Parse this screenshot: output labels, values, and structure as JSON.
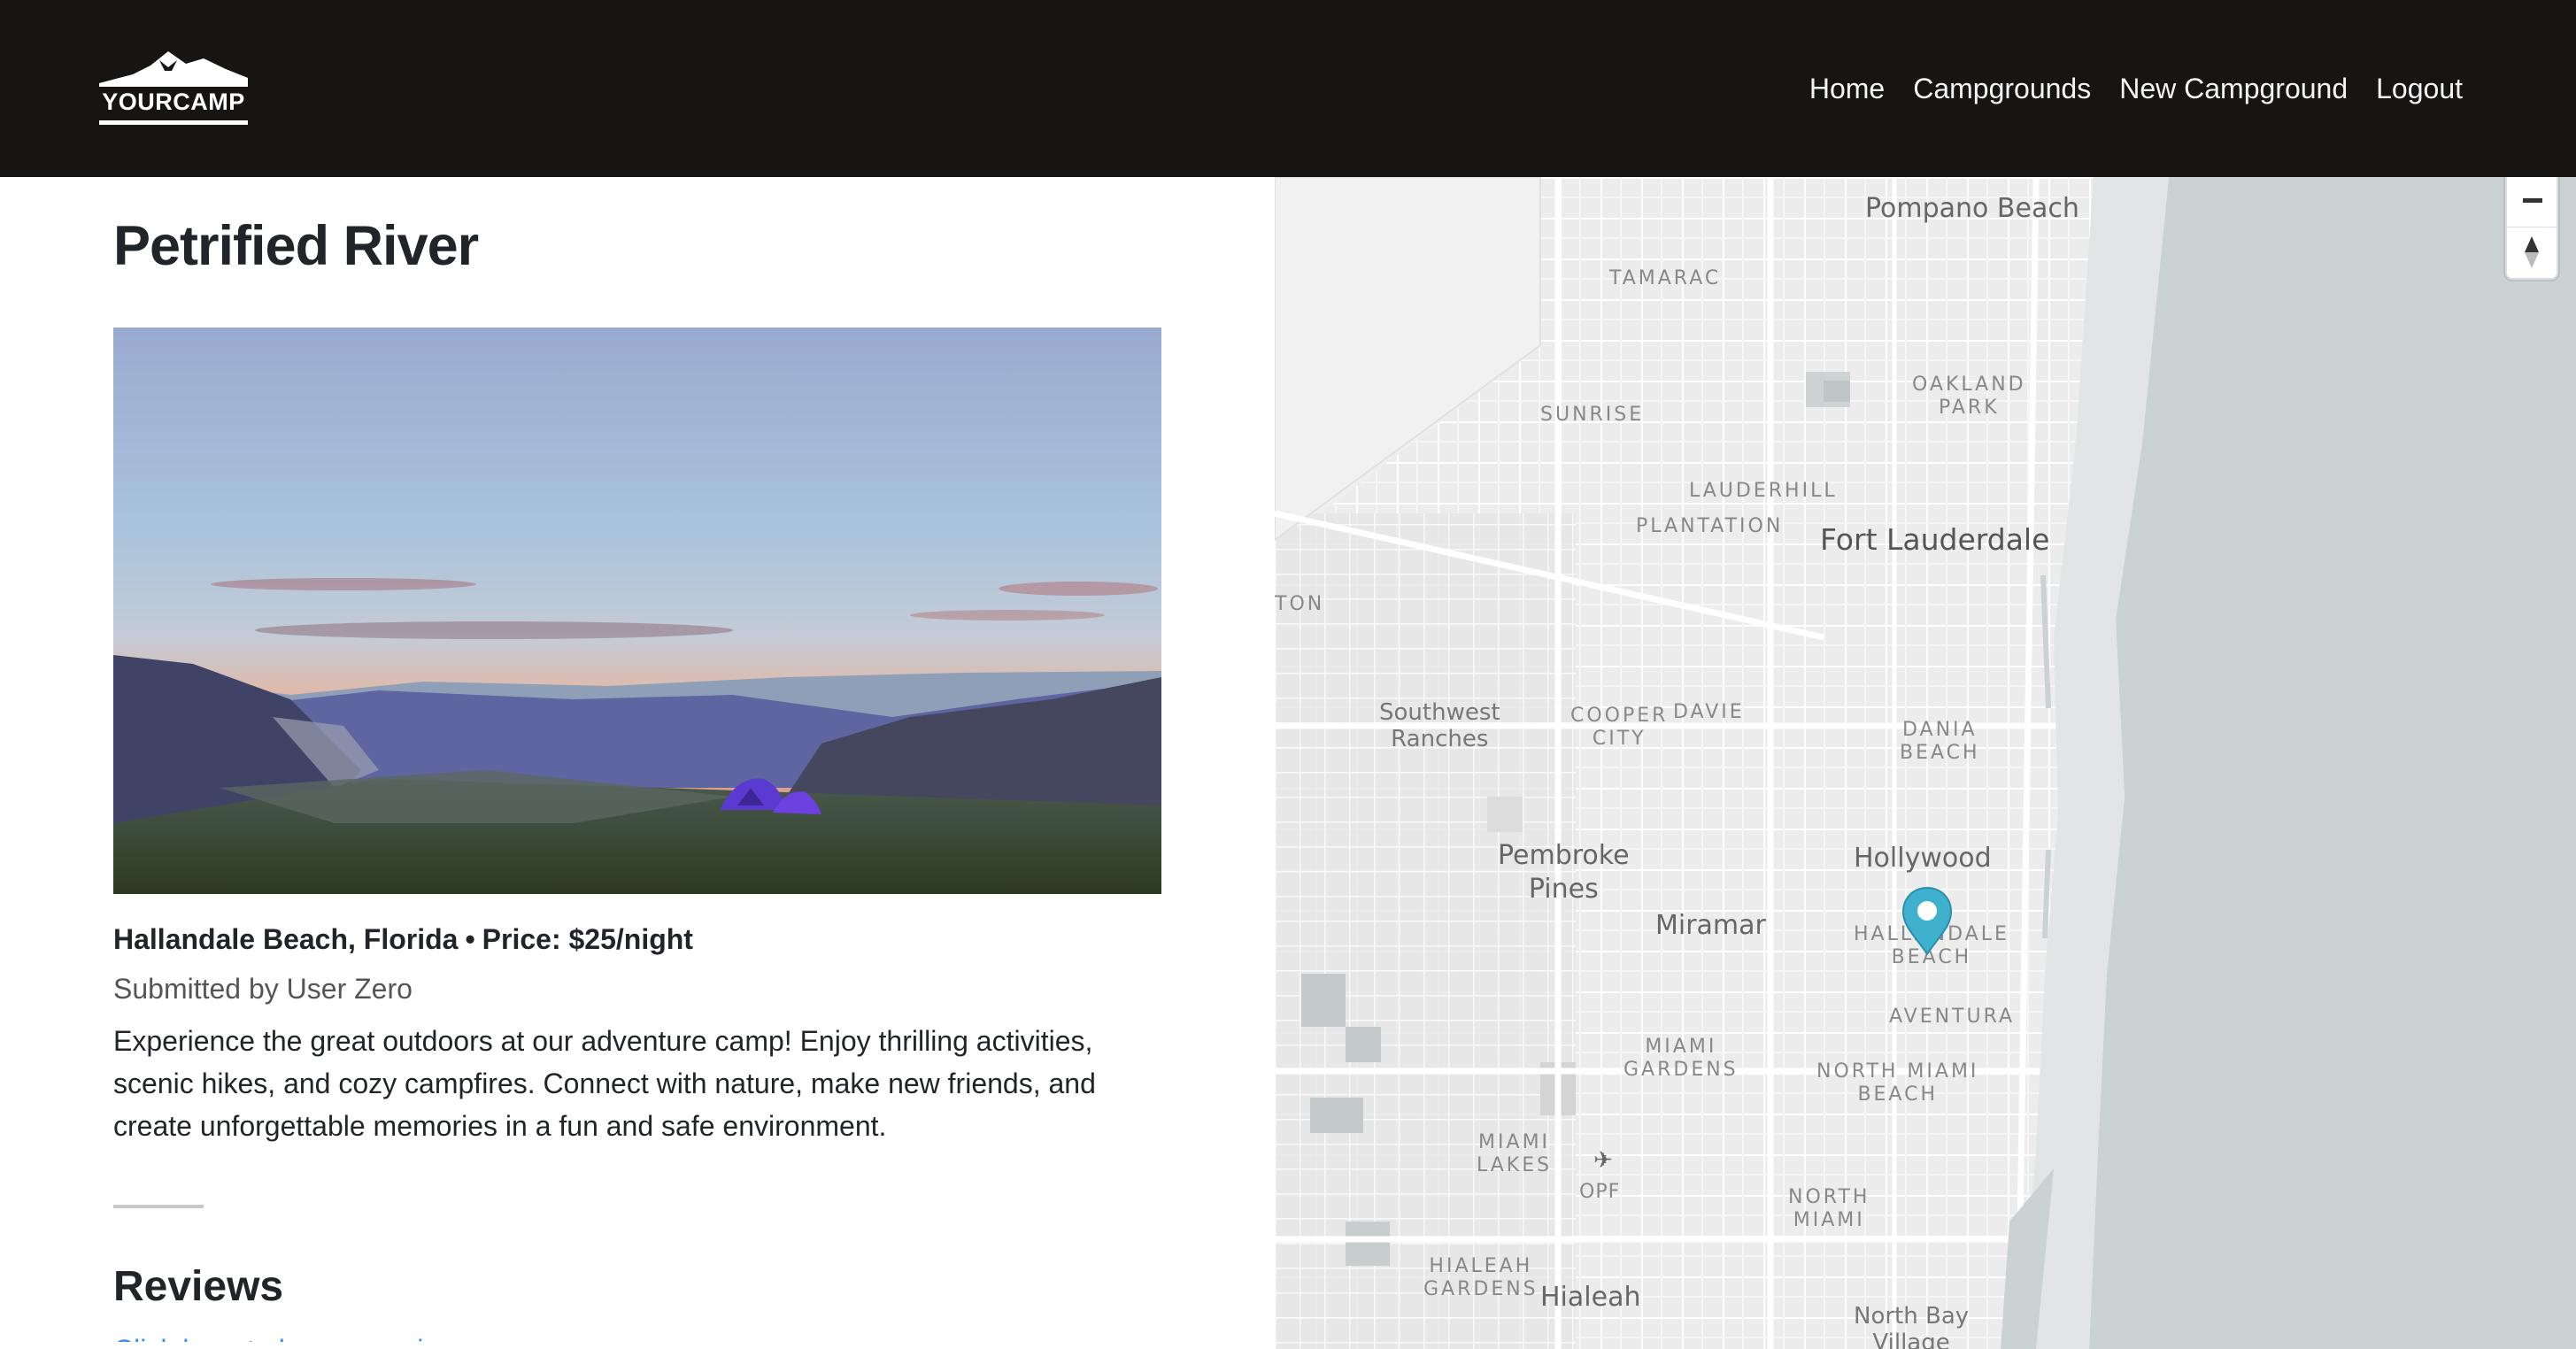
{
  "brand": {
    "name": "YOURCAMP"
  },
  "nav": {
    "links": [
      "Home",
      "Campgrounds",
      "New Campground",
      "Logout"
    ]
  },
  "campground": {
    "title": "Petrified River",
    "location": "Hallandale Beach, Florida",
    "separator": "•",
    "price": "Price: $25/night",
    "submitted_by": "Submitted by User Zero",
    "description": "Experience the great outdoors at our adventure camp! Enjoy thrilling activities, scenic hikes, and cozy campfires. Connect with nature, make new friends, and create unforgettable memories in a fun and safe environment."
  },
  "reviews": {
    "heading": "Reviews",
    "leave_review_link": "Click here to leave a review"
  },
  "map": {
    "labels": {
      "pompano_beach": "Pompano Beach",
      "tamarac": "TAMARAC",
      "oakland_park": "OAKLAND\nPARK",
      "sunrise": "SUNRISE",
      "lauderhill": "LAUDERHILL",
      "plantation": "PLANTATION",
      "fort_lauderdale": "Fort Lauderdale",
      "ton": "TON",
      "southwest_ranches": "Southwest\nRanches",
      "cooper_city": "COOPER\nCITY",
      "davie": "DAVIE",
      "dania_beach": "DANIA\nBEACH",
      "pembroke_pines": "Pembroke\nPines",
      "hollywood": "Hollywood",
      "miramar": "Miramar",
      "hallandale_beach": "HALLANDALE\nBEACH",
      "aventura": "AVENTURA",
      "miami_gardens": "MIAMI\nGARDENS",
      "north_miami_beach": "NORTH MIAMI\nBEACH",
      "miami_lakes": "MIAMI\nLAKES",
      "opf": "OPF",
      "north_miami": "NORTH\nMIAMI",
      "hialeah_gardens": "HIALEAH\nGARDENS",
      "hialeah": "Hialeah",
      "north_bay_village": "North Bay\nVillage"
    },
    "colors": {
      "land": "#e8e8e8",
      "water": "#cad2d3",
      "marker": "#3fb1ce"
    }
  }
}
